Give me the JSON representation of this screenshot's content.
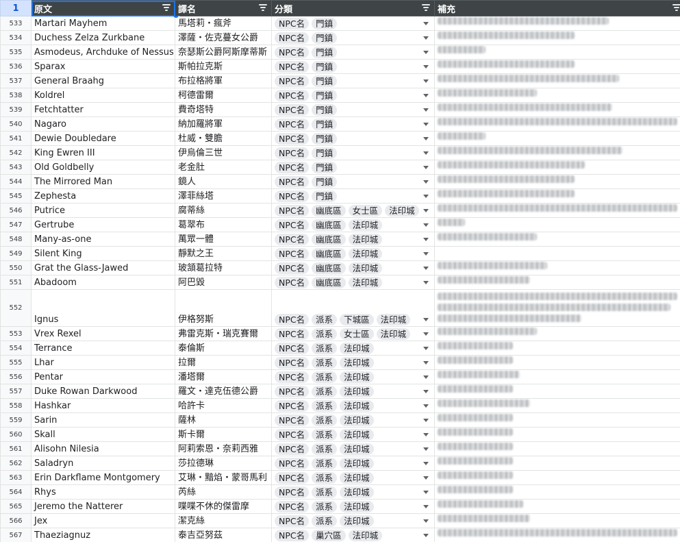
{
  "header": {
    "row_number": "1",
    "col_a": "原文",
    "col_b": "譯名",
    "col_c": "分類",
    "col_d": "補充"
  },
  "rows": [
    {
      "n": "533",
      "orig": "Martari Mayhem",
      "trans": "馬塔莉・瘋斧",
      "tags": [
        "NPC名",
        "門鎮"
      ],
      "note_w": 250
    },
    {
      "n": "534",
      "orig": "Duchess Zelza Zurkbane",
      "trans": "澤薩・佐克蔓女公爵",
      "tags": [
        "NPC名",
        "門鎮"
      ],
      "note_w": 200
    },
    {
      "n": "535",
      "orig": "Asmodeus, Archduke of Nessus",
      "trans": "奈瑟斯公爵阿斯摩蒂斯",
      "tags": [
        "NPC名",
        "門鎮"
      ],
      "note_w": 70
    },
    {
      "n": "536",
      "orig": "Sparax",
      "trans": "斯帕拉克斯",
      "tags": [
        "NPC名",
        "門鎮"
      ],
      "note_w": 200
    },
    {
      "n": "537",
      "orig": "General Braahg",
      "trans": "布拉格將軍",
      "tags": [
        "NPC名",
        "門鎮"
      ],
      "note_w": 265
    },
    {
      "n": "538",
      "orig": "Koldrel",
      "trans": "柯德雷爾",
      "tags": [
        "NPC名",
        "門鎮"
      ],
      "note_w": 145
    },
    {
      "n": "539",
      "orig": "Fetchtatter",
      "trans": "費奇塔特",
      "tags": [
        "NPC名",
        "門鎮"
      ],
      "note_w": 255
    },
    {
      "n": "540",
      "orig": "Nagaro",
      "trans": "納加羅將軍",
      "tags": [
        "NPC名",
        "門鎮"
      ],
      "note_w": 350
    },
    {
      "n": "541",
      "orig": "Dewie Doubledare",
      "trans": "杜威・雙膽",
      "tags": [
        "NPC名",
        "門鎮"
      ],
      "note_w": 70
    },
    {
      "n": "542",
      "orig": "King Ewren III",
      "trans": "伊烏倫三世",
      "tags": [
        "NPC名",
        "門鎮"
      ],
      "note_w": 270
    },
    {
      "n": "543",
      "orig": "Old Goldbelly",
      "trans": "老金肚",
      "tags": [
        "NPC名",
        "門鎮"
      ],
      "note_w": 215
    },
    {
      "n": "544",
      "orig": "The Mirrored Man",
      "trans": "鏡人",
      "tags": [
        "NPC名",
        "門鎮"
      ],
      "note_w": 200
    },
    {
      "n": "545",
      "orig": "Zephesta",
      "trans": "澤菲絲塔",
      "tags": [
        "NPC名",
        "門鎮"
      ],
      "note_w": 200
    },
    {
      "n": "546",
      "orig": "Putrice",
      "trans": "腐蒂絲",
      "tags": [
        "NPC名",
        "幽底區",
        "女士區",
        "法印城"
      ],
      "note_w": 350
    },
    {
      "n": "547",
      "orig": "Gertrube",
      "trans": "葛翠布",
      "tags": [
        "NPC名",
        "幽底區",
        "法印城"
      ],
      "note_w": 40
    },
    {
      "n": "548",
      "orig": "Many-as-one",
      "trans": "萬眾一體",
      "tags": [
        "NPC名",
        "幽底區",
        "法印城"
      ],
      "note_w": 145
    },
    {
      "n": "549",
      "orig": "Silent King",
      "trans": "靜默之王",
      "tags": [
        "NPC名",
        "幽底區",
        "法印城"
      ],
      "note_w": 0
    },
    {
      "n": "550",
      "orig": "Grat the Glass-Jawed",
      "trans": "玻頷葛拉特",
      "tags": [
        "NPC名",
        "幽底區",
        "法印城"
      ],
      "note_w": 160
    },
    {
      "n": "551",
      "orig": "Abadoom",
      "trans": "阿巴毀",
      "tags": [
        "NPC名",
        "幽底區",
        "法印城"
      ],
      "note_w": 135
    },
    {
      "n": "552",
      "orig": "Ignus",
      "trans": "伊格努斯",
      "tags": [
        "NPC名",
        "派系",
        "下城區",
        "法印城"
      ],
      "note_w": 350,
      "tall": true
    },
    {
      "n": "553",
      "orig": "Vrex Rexel",
      "trans": "弗雷克斯・瑞克賽爾",
      "tags": [
        "NPC名",
        "派系",
        "女士區",
        "法印城"
      ],
      "note_w": 145
    },
    {
      "n": "554",
      "orig": "Terrance",
      "trans": "泰倫斯",
      "tags": [
        "NPC名",
        "派系",
        "法印城"
      ],
      "note_w": 110
    },
    {
      "n": "555",
      "orig": "Lhar",
      "trans": "拉爾",
      "tags": [
        "NPC名",
        "派系",
        "法印城"
      ],
      "note_w": 110
    },
    {
      "n": "556",
      "orig": "Pentar",
      "trans": "潘塔爾",
      "tags": [
        "NPC名",
        "派系",
        "法印城"
      ],
      "note_w": 120
    },
    {
      "n": "557",
      "orig": "Duke Rowan Darkwood",
      "trans": "羅文・達克伍德公爵",
      "tags": [
        "NPC名",
        "派系",
        "法印城"
      ],
      "note_w": 110
    },
    {
      "n": "558",
      "orig": "Hashkar",
      "trans": "哈許卡",
      "tags": [
        "NPC名",
        "派系",
        "法印城"
      ],
      "note_w": 135
    },
    {
      "n": "559",
      "orig": "Sarin",
      "trans": "薩林",
      "tags": [
        "NPC名",
        "派系",
        "法印城"
      ],
      "note_w": 110
    },
    {
      "n": "560",
      "orig": "Skall",
      "trans": "斯卡爾",
      "tags": [
        "NPC名",
        "派系",
        "法印城"
      ],
      "note_w": 110
    },
    {
      "n": "561",
      "orig": "Alisohn Nilesia",
      "trans": "阿莉索恩・奈莉西雅",
      "tags": [
        "NPC名",
        "派系",
        "法印城"
      ],
      "note_w": 110
    },
    {
      "n": "562",
      "orig": "Saladryn",
      "trans": "莎拉德琳",
      "tags": [
        "NPC名",
        "派系",
        "法印城"
      ],
      "note_w": 110
    },
    {
      "n": "563",
      "orig": "Erin Darkflame Montgomery",
      "trans": "艾琳・黯焰・蒙哥馬利",
      "tags": [
        "NPC名",
        "派系",
        "法印城"
      ],
      "note_w": 110
    },
    {
      "n": "564",
      "orig": "Rhys",
      "trans": "芮絲",
      "tags": [
        "NPC名",
        "派系",
        "法印城"
      ],
      "note_w": 110
    },
    {
      "n": "565",
      "orig": "Jeremo the Natterer",
      "trans": "喋喋不休的傑雷摩",
      "tags": [
        "NPC名",
        "派系",
        "法印城"
      ],
      "note_w": 125
    },
    {
      "n": "566",
      "orig": "Jex",
      "trans": "潔克絲",
      "tags": [
        "NPC名",
        "派系",
        "法印城"
      ],
      "note_w": 135
    },
    {
      "n": "567",
      "orig": "Thaeziagnuz",
      "trans": "泰吉亞努茲",
      "tags": [
        "NPC名",
        "巢穴區",
        "法印城"
      ],
      "note_w": 350
    }
  ],
  "colors": {
    "header_bg": "#3f4446",
    "row_header_bg": "#f8f9fa",
    "chip_bg": "#e8eaed",
    "selection": "#1a73e8"
  },
  "icons": {
    "filter": "filter-icon",
    "dropdown": "dropdown-arrow-icon"
  }
}
